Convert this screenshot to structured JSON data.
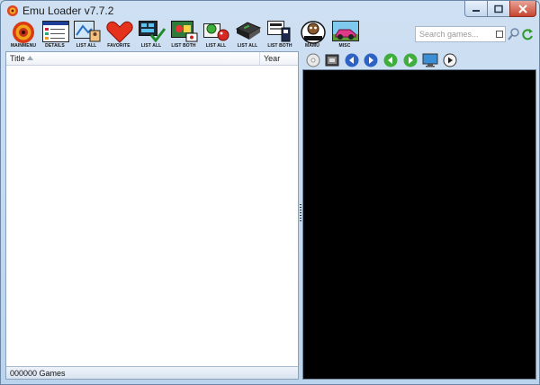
{
  "window": {
    "title": "Emu Loader v7.7.2"
  },
  "toolbar": {
    "buttons": [
      {
        "label": "MAINMENU"
      },
      {
        "label": "DETAILS"
      },
      {
        "label": "LIST ALL"
      },
      {
        "label": "FAVORITE"
      },
      {
        "label": "LIST ALL"
      },
      {
        "label": "LIST BOTH"
      },
      {
        "label": "LIST ALL"
      },
      {
        "label": "LIST ALL"
      },
      {
        "label": "LIST BOTH"
      },
      {
        "label": "MAMU"
      },
      {
        "label": "MISC"
      }
    ],
    "search_placeholder": "Search games..."
  },
  "game_list": {
    "columns": [
      "Title",
      "Year"
    ],
    "status": "000000 Games"
  },
  "colors": {
    "accent": "#3a78c9",
    "green": "#3fae3c",
    "preview_bg": "#000000"
  }
}
